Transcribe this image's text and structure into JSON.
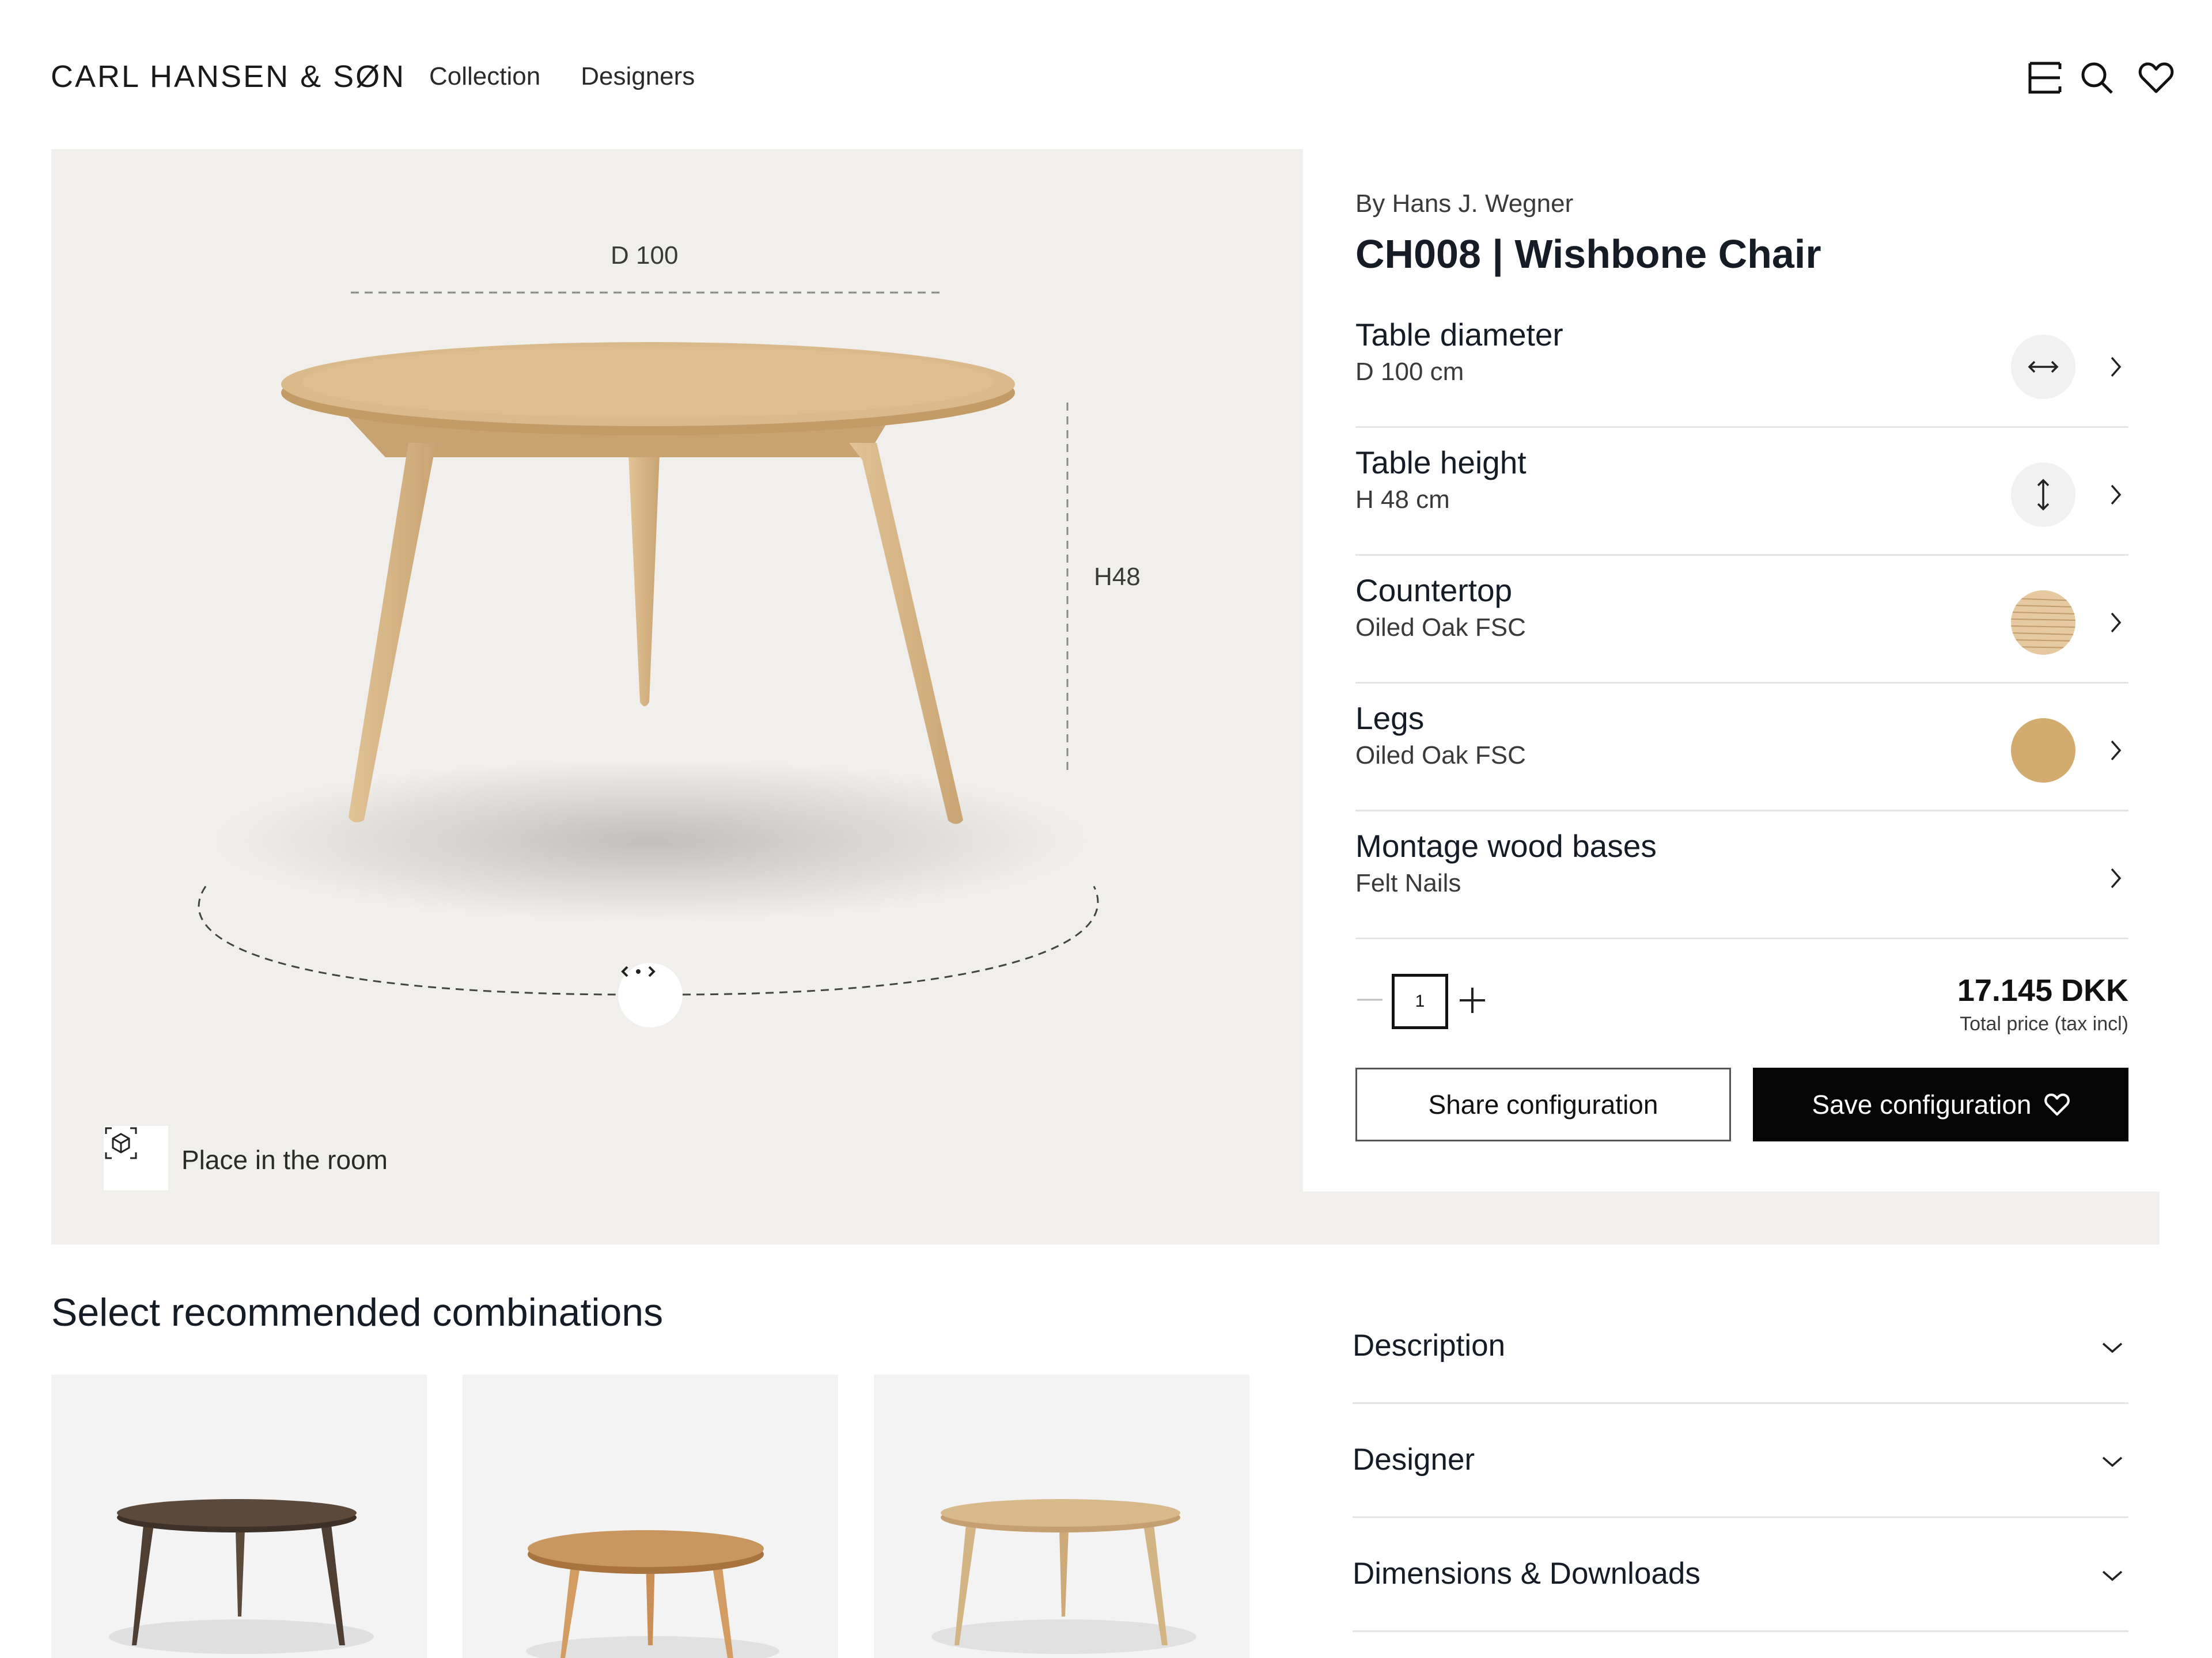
{
  "header": {
    "brand": "CARL HANSEN & SØN",
    "nav": [
      "Collection",
      "Designers"
    ],
    "icons": [
      "menu-icon",
      "search-icon",
      "heart-icon"
    ]
  },
  "viewer": {
    "diameter_label": "D 100",
    "height_label": "H48",
    "place_label": "Place in the room",
    "place_icon": "ar-cube-icon",
    "rotate_icon": "rotate-arrows-icon",
    "background": "#f1efeb"
  },
  "product": {
    "designer": "By Hans J. Wegner",
    "name": "CH008 | Wishbone Chair",
    "options": [
      {
        "title": "Table diameter",
        "value": "D 100 cm",
        "icon": "horizontal-arrows-icon"
      },
      {
        "title": "Table height",
        "value": "H 48 cm",
        "icon": "vertical-arrows-icon"
      },
      {
        "title": "Countertop",
        "value": "Oiled Oak FSC",
        "icon": "oak-grain-swatch"
      },
      {
        "title": "Legs",
        "value": "Oiled Oak FSC",
        "icon": "oak-swatch"
      },
      {
        "title": "Montage wood bases",
        "value": "Felt Nails",
        "icon": ""
      }
    ],
    "quantity": "1",
    "price": "17.145 DKK",
    "price_note": "Total price (tax incl)",
    "share_label": "Share configuration",
    "save_label": "Save configuration",
    "colors": {
      "accent": "#050505",
      "oak": "#d6b483"
    }
  },
  "recommendations": {
    "title": "Select recommended combinations",
    "items": [
      {
        "finish": "smoked oak",
        "color": "#5b4a3c"
      },
      {
        "finish": "cherry",
        "color": "#c99660"
      },
      {
        "finish": "oak",
        "color": "#d7b98a"
      }
    ]
  },
  "accordion": [
    "Description",
    "Designer",
    "Dimensions & Downloads"
  ]
}
